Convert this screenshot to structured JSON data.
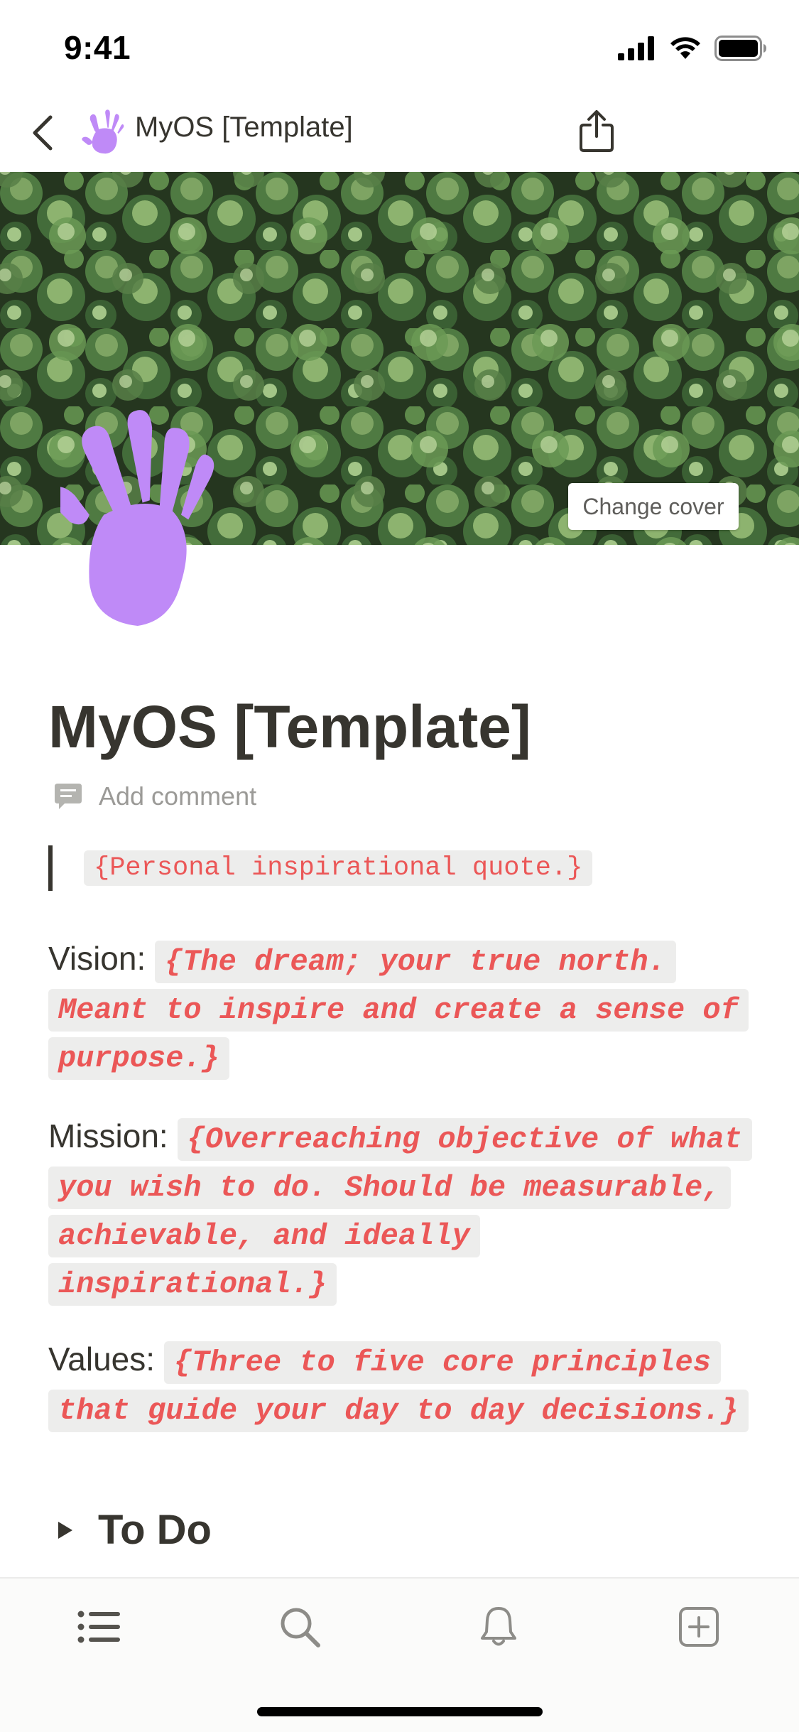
{
  "status_bar": {
    "time": "9:41"
  },
  "nav": {
    "title": "MyOS [Template]"
  },
  "cover": {
    "change_cover_label": "Change cover"
  },
  "page": {
    "title": "MyOS [Template]",
    "add_comment": "Add comment",
    "quote": "{Personal inspirational quote.}",
    "vision_label": "Vision:",
    "vision_text": "{The dream; your true north. Meant to inspire and create a sense of purpose.}",
    "mission_label": "Mission:",
    "mission_text": "{Overreaching objective of what you wish to do. Should be measurable, achievable, and ideally inspirational.}",
    "values_label": "Values:",
    "values_text": "{Three to five core principles that guide your day to day decisions.}",
    "todo_title": "To Do"
  },
  "colors": {
    "accent_purple": "#bf8af7",
    "code_red": "#eb5757",
    "code_bg": "#ededec",
    "text": "#37352f"
  },
  "icons": [
    "back-chevron-icon",
    "hand-icon",
    "share-icon",
    "comment-icon",
    "triangle-right-icon",
    "list-icon",
    "search-icon",
    "bell-icon",
    "plus-square-icon"
  ]
}
